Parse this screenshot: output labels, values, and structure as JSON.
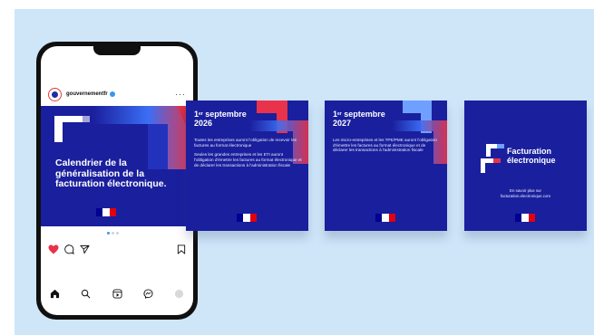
{
  "instagram": {
    "account_name": "gouvernementfr",
    "more_icon": "more-horizontal-icon",
    "post_title": "Calendrier de la généralisation de la facturation électronique.",
    "carousel_dots": 3,
    "actions": [
      "heart-icon",
      "comment-icon",
      "share-icon",
      "bookmark-icon"
    ],
    "tabbar": [
      "home-icon",
      "search-icon",
      "reels-icon",
      "messenger-icon",
      "profile-icon"
    ],
    "colors": {
      "heart": "#e8334a",
      "verified": "#3897f0"
    }
  },
  "cards": [
    {
      "date_day": "1",
      "date_suffix": "er",
      "date_month": " septembre",
      "date_year": "2026",
      "paragraphs": [
        "Toutes les entreprises auront l'obligation de recevoir les factures au format électronique",
        "Seules les grandes entreprises et les ETI auront l'obligation d'émettre les factures au format électronique et de déclarer les transactions à l'administration fiscale"
      ]
    },
    {
      "date_day": "1",
      "date_suffix": "er",
      "date_month": " septembre",
      "date_year": "2027",
      "paragraphs": [
        "Les micro-entreprises et les TPE/PME auront l'obligation d'émettre les factures au format électronique et de déclarer les transactions à l'administration fiscale"
      ]
    },
    {
      "logo_line1": "Facturation",
      "logo_line2": "électronique",
      "more_info_line1": "En savoir plus sur",
      "more_info_line2": "facturation.electronique.com"
    }
  ],
  "colors": {
    "background": "#cfe6f9",
    "navy": "#1a1f9d",
    "accent_red": "#e8334a",
    "accent_blue": "#3b6ef5",
    "flag_blue": "#000091",
    "flag_white": "#ffffff",
    "flag_red": "#e1000f"
  }
}
